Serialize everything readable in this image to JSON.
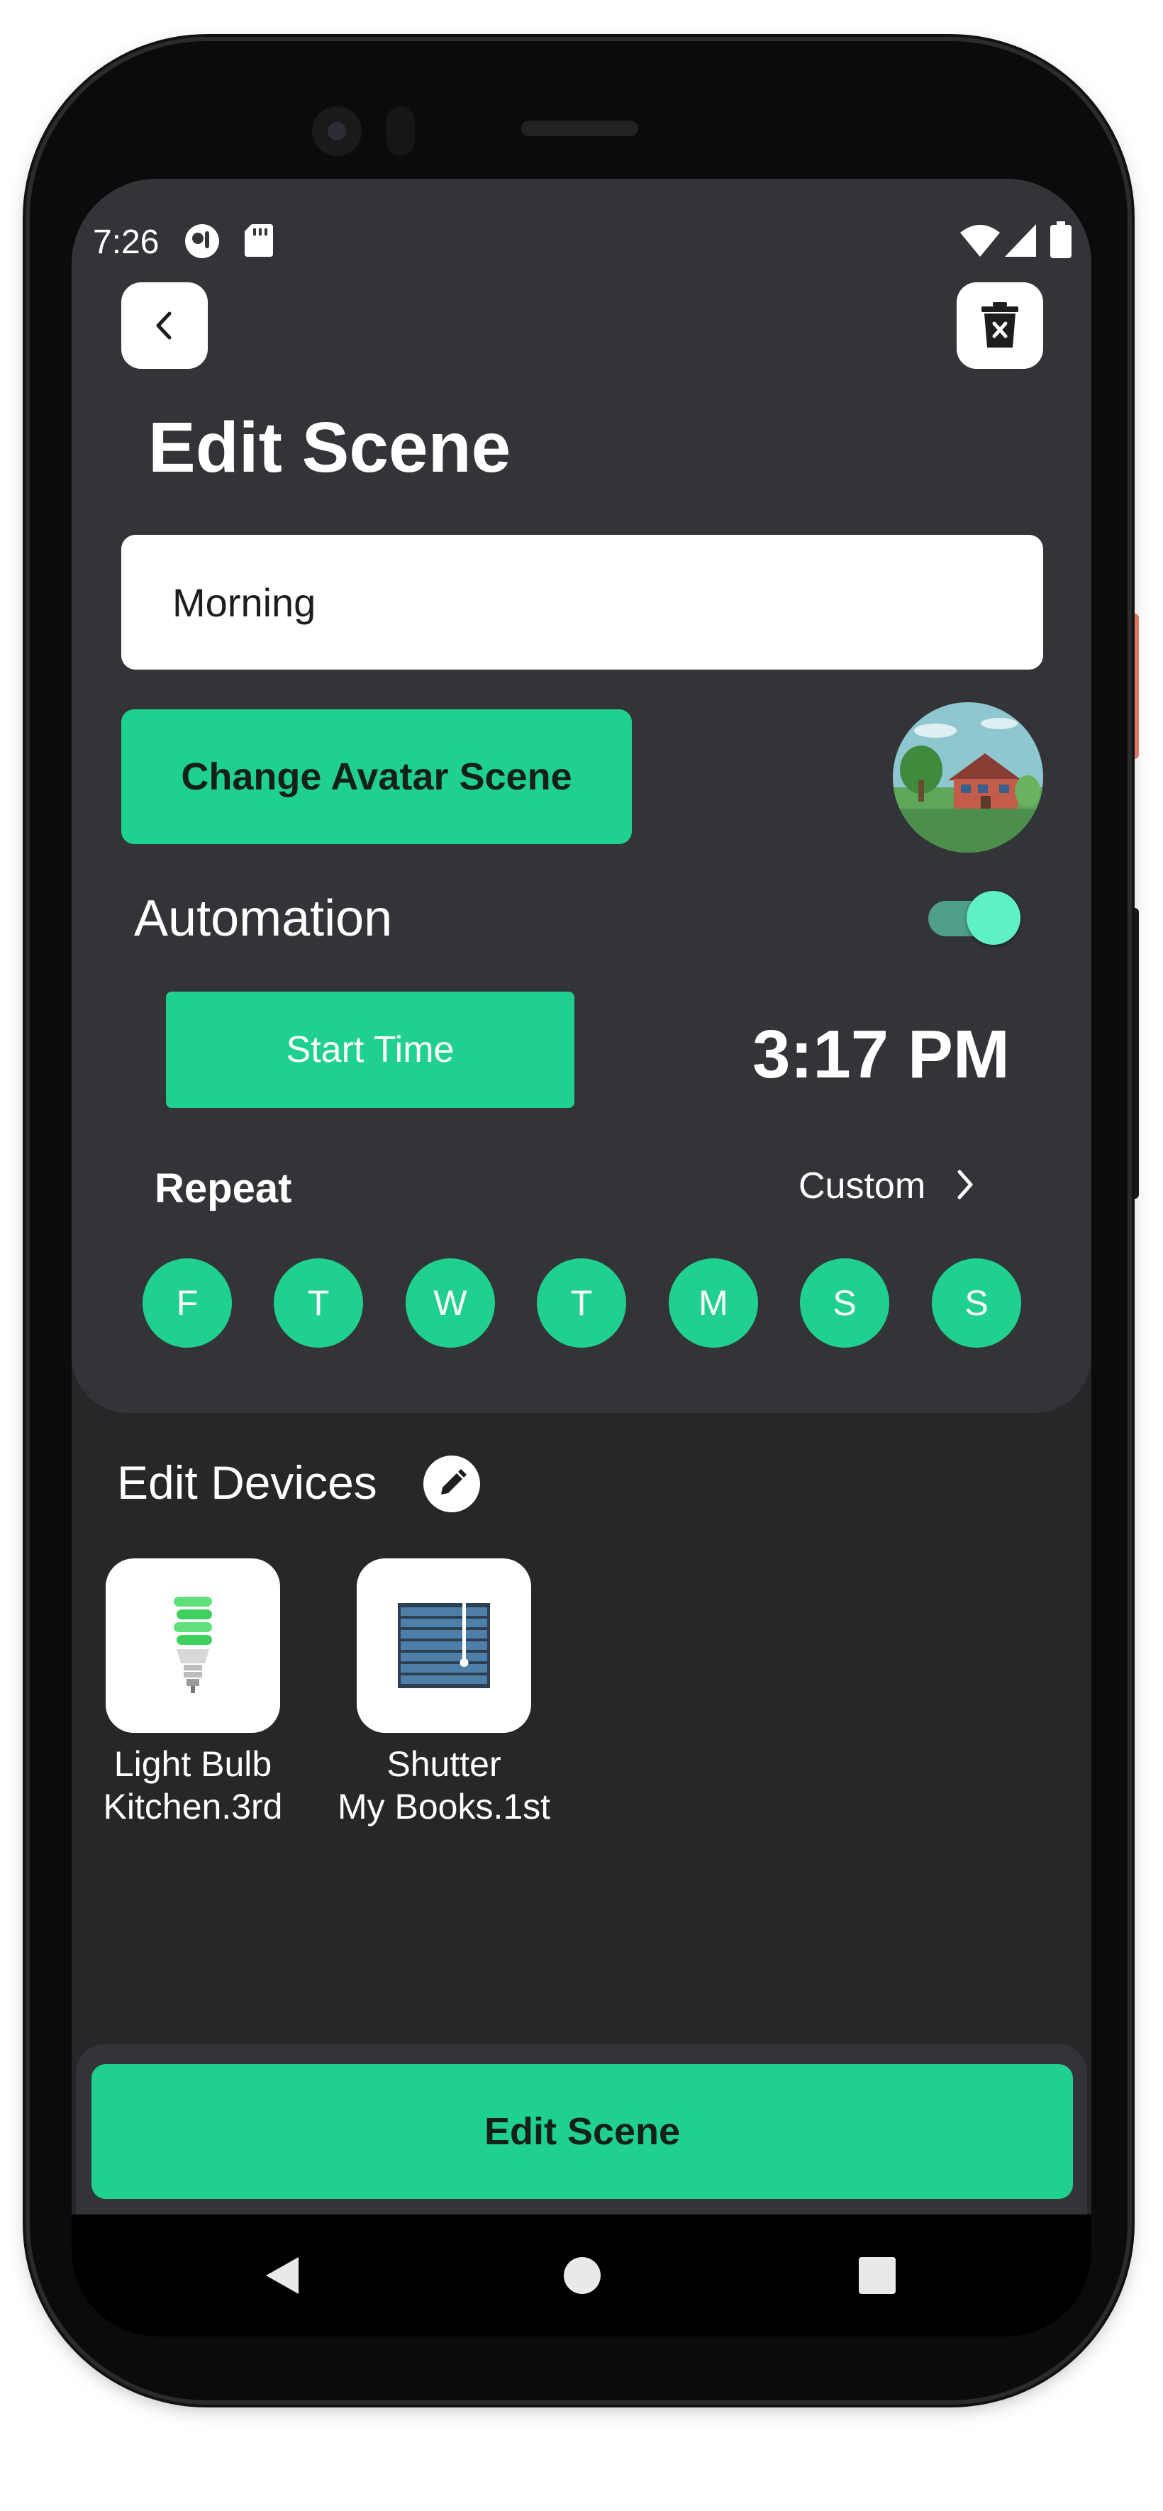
{
  "status_bar": {
    "time": "7:26"
  },
  "header": {
    "back_icon": "chevron-left-icon",
    "delete_icon": "trash-icon",
    "title": "Edit Scene"
  },
  "scene_name": {
    "value": "Morning"
  },
  "avatar": {
    "button_label": "Change Avatar Scene"
  },
  "automation": {
    "label": "Automation",
    "enabled": true,
    "start_time_label": "Start Time",
    "time_value": "3:17 PM"
  },
  "repeat": {
    "label": "Repeat",
    "mode": "Custom",
    "days": [
      "F",
      "T",
      "W",
      "T",
      "M",
      "S",
      "S"
    ]
  },
  "devices": {
    "heading": "Edit Devices",
    "items": [
      {
        "name": "Light Bulb",
        "location": "Kitchen.3rd",
        "icon": "light-bulb-icon"
      },
      {
        "name": "Shutter",
        "location": "My Books.1st",
        "icon": "shutter-icon"
      }
    ]
  },
  "footer": {
    "edit_scene_label": "Edit Scene"
  },
  "colors": {
    "accent": "#20d08e",
    "background": "#262729",
    "card": "#333438"
  }
}
